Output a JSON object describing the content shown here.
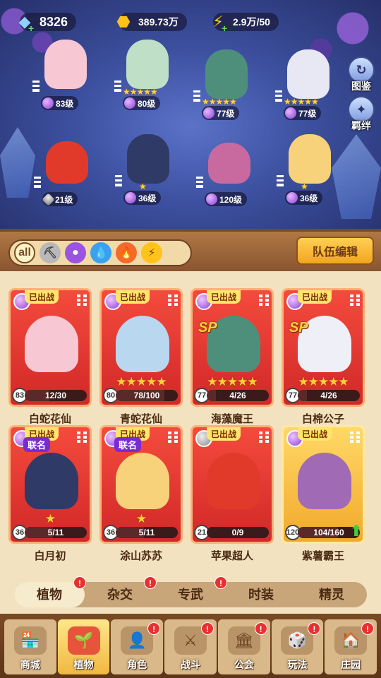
{
  "resources": {
    "gems": "8326",
    "coins": "389.73万",
    "energy": "2.9万/50"
  },
  "side_buttons": {
    "codex": "图鉴",
    "bond": "羁绊"
  },
  "formation": [
    {
      "level": "83级",
      "stars": "",
      "color": "#f7c7d3"
    },
    {
      "level": "80级",
      "stars": "★★★★★",
      "color": "#bfe0c6"
    },
    {
      "level": "77级",
      "stars": "★★★★★",
      "color": "#4e8f7c"
    },
    {
      "level": "77级",
      "stars": "★★★★★",
      "color": "#e8e8f5"
    },
    {
      "level": "21级",
      "stars": "",
      "color": "#e23a2a"
    },
    {
      "level": "36级",
      "stars": "★",
      "color": "#2f3a66"
    },
    {
      "level": "120级",
      "stars": "",
      "color": "#c86aa0"
    },
    {
      "level": "36级",
      "stars": "★",
      "color": "#f7d27a"
    }
  ],
  "filters": {
    "all": "all"
  },
  "team_edit": "队伍编辑",
  "cards": [
    {
      "name": "白蛇花仙",
      "banner": "已出战",
      "tag": "",
      "sp": "",
      "stars": "",
      "level": "83",
      "progress": "12/30",
      "ratio": 0.4,
      "art": "#f7c7d3",
      "gold": false
    },
    {
      "name": "青蛇花仙",
      "banner": "已出战",
      "tag": "",
      "sp": "",
      "stars": "★★★★★",
      "level": "80",
      "progress": "78/100",
      "ratio": 0.78,
      "art": "#b9d7ef",
      "gold": false
    },
    {
      "name": "海藻魔王",
      "banner": "已出战",
      "tag": "",
      "sp": "SP",
      "stars": "★★★★★",
      "level": "77",
      "progress": "4/26",
      "ratio": 0.15,
      "art": "#4e8f7c",
      "gold": false
    },
    {
      "name": "白棉公子",
      "banner": "已出战",
      "tag": "",
      "sp": "SP",
      "stars": "★★★★★",
      "level": "77",
      "progress": "4/26",
      "ratio": 0.15,
      "art": "#efeff7",
      "gold": false
    },
    {
      "name": "白月初",
      "banner": "已出战",
      "tag": "联名",
      "sp": "",
      "stars": "★",
      "level": "36",
      "progress": "5/11",
      "ratio": 0.45,
      "art": "#2f3a66",
      "gold": false
    },
    {
      "name": "涂山苏苏",
      "banner": "已出战",
      "tag": "联名",
      "sp": "",
      "stars": "★",
      "level": "36",
      "progress": "5/11",
      "ratio": 0.45,
      "art": "#f7d27a",
      "gold": false
    },
    {
      "name": "苹果超人",
      "banner": "已出战",
      "tag": "",
      "sp": "",
      "stars": "",
      "level": "21",
      "progress": "0/9",
      "ratio": 0.0,
      "art": "#e23a2a",
      "gold": false
    },
    {
      "name": "紫薯霸王",
      "banner": "已出战",
      "tag": "",
      "sp": "",
      "stars": "",
      "level": "120",
      "progress": "104/160",
      "ratio": 0.65,
      "art": "#a06ab5",
      "gold": true
    }
  ],
  "tabs": [
    {
      "label": "植物",
      "badge": "!",
      "active": true
    },
    {
      "label": "杂交",
      "badge": "!",
      "active": false
    },
    {
      "label": "专武",
      "badge": "!",
      "active": false
    },
    {
      "label": "时装",
      "badge": "",
      "active": false
    },
    {
      "label": "精灵",
      "badge": "",
      "active": false
    }
  ],
  "nav": [
    {
      "label": "商城",
      "badge": "",
      "icon": "shop-icon",
      "active": false
    },
    {
      "label": "植物",
      "badge": "",
      "icon": "plant-icon",
      "active": true
    },
    {
      "label": "角色",
      "badge": "!",
      "icon": "character-icon",
      "active": false
    },
    {
      "label": "战斗",
      "badge": "!",
      "icon": "battle-icon",
      "active": false
    },
    {
      "label": "公会",
      "badge": "!",
      "icon": "guild-icon",
      "active": false
    },
    {
      "label": "玩法",
      "badge": "!",
      "icon": "gameplay-icon",
      "active": false
    },
    {
      "label": "庄园",
      "badge": "!",
      "icon": "manor-icon",
      "active": false
    }
  ]
}
